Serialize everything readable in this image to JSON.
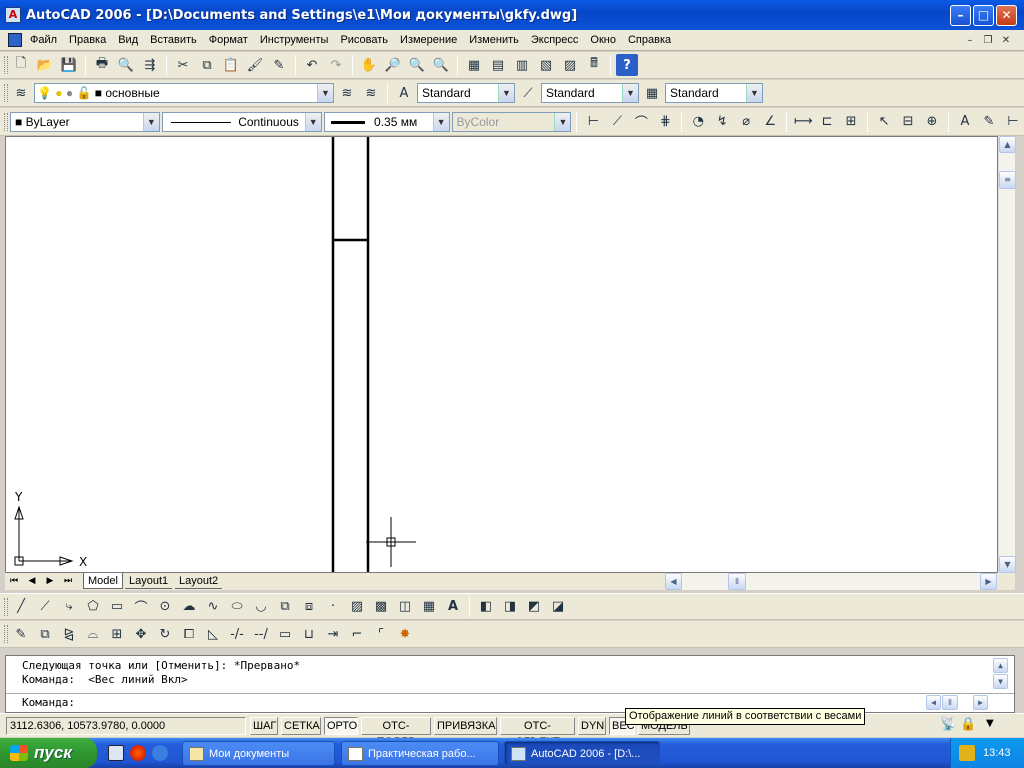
{
  "window": {
    "title": "AutoCAD 2006 - [D:\\Documents and Settings\\e1\\Мои документы\\gkfy.dwg]",
    "minimize": "–",
    "maximize": "□",
    "close": "✕",
    "doc_minimize": "–",
    "doc_restore": "❐",
    "doc_close": "✕"
  },
  "menu": [
    "Файл",
    "Правка",
    "Вид",
    "Вставить",
    "Формат",
    "Инструменты",
    "Рисовать",
    "Измерение",
    "Изменить",
    "Экспресс",
    "Окно",
    "Справка"
  ],
  "layers": {
    "current_layer": "основные"
  },
  "styles": {
    "text_style": "Standard",
    "dim_style": "Standard",
    "table_style": "Standard"
  },
  "properties": {
    "color": "ByLayer",
    "linetype": "Continuous",
    "lineweight": "0.35 мм",
    "plotstyle": "ByColor"
  },
  "ucs": {
    "x_label": "X",
    "y_label": "Y"
  },
  "tabs": [
    "Model",
    "Layout1",
    "Layout2"
  ],
  "command": {
    "history": [
      "Следующая точка или [Отменить]: *Прервано*",
      "Команда:  <Вес линий Вкл>"
    ],
    "prompt": "Команда:"
  },
  "status": {
    "coords": "3112.6306, 10573.9780, 0.0000",
    "buttons": [
      "ШАГ",
      "СЕТКА",
      "ОРТО",
      "ОТС-ПОЛЯР",
      "ПРИВЯЗКА",
      "ОТС-ОБЪЕКТ",
      "DYN",
      "ВЕС",
      "МОДЕЛЬ"
    ],
    "tooltip": "Отображение линий в соответствии с весами"
  },
  "taskbar": {
    "start": "пуск",
    "tasks": [
      "Мои документы",
      "Практическая рабо...",
      "AutoCAD 2006 - [D:\\..."
    ],
    "clock": "13:43"
  },
  "colors": {
    "titlebar": "#0a53d8",
    "taskbar": "#245edb",
    "start": "#2f962f"
  }
}
